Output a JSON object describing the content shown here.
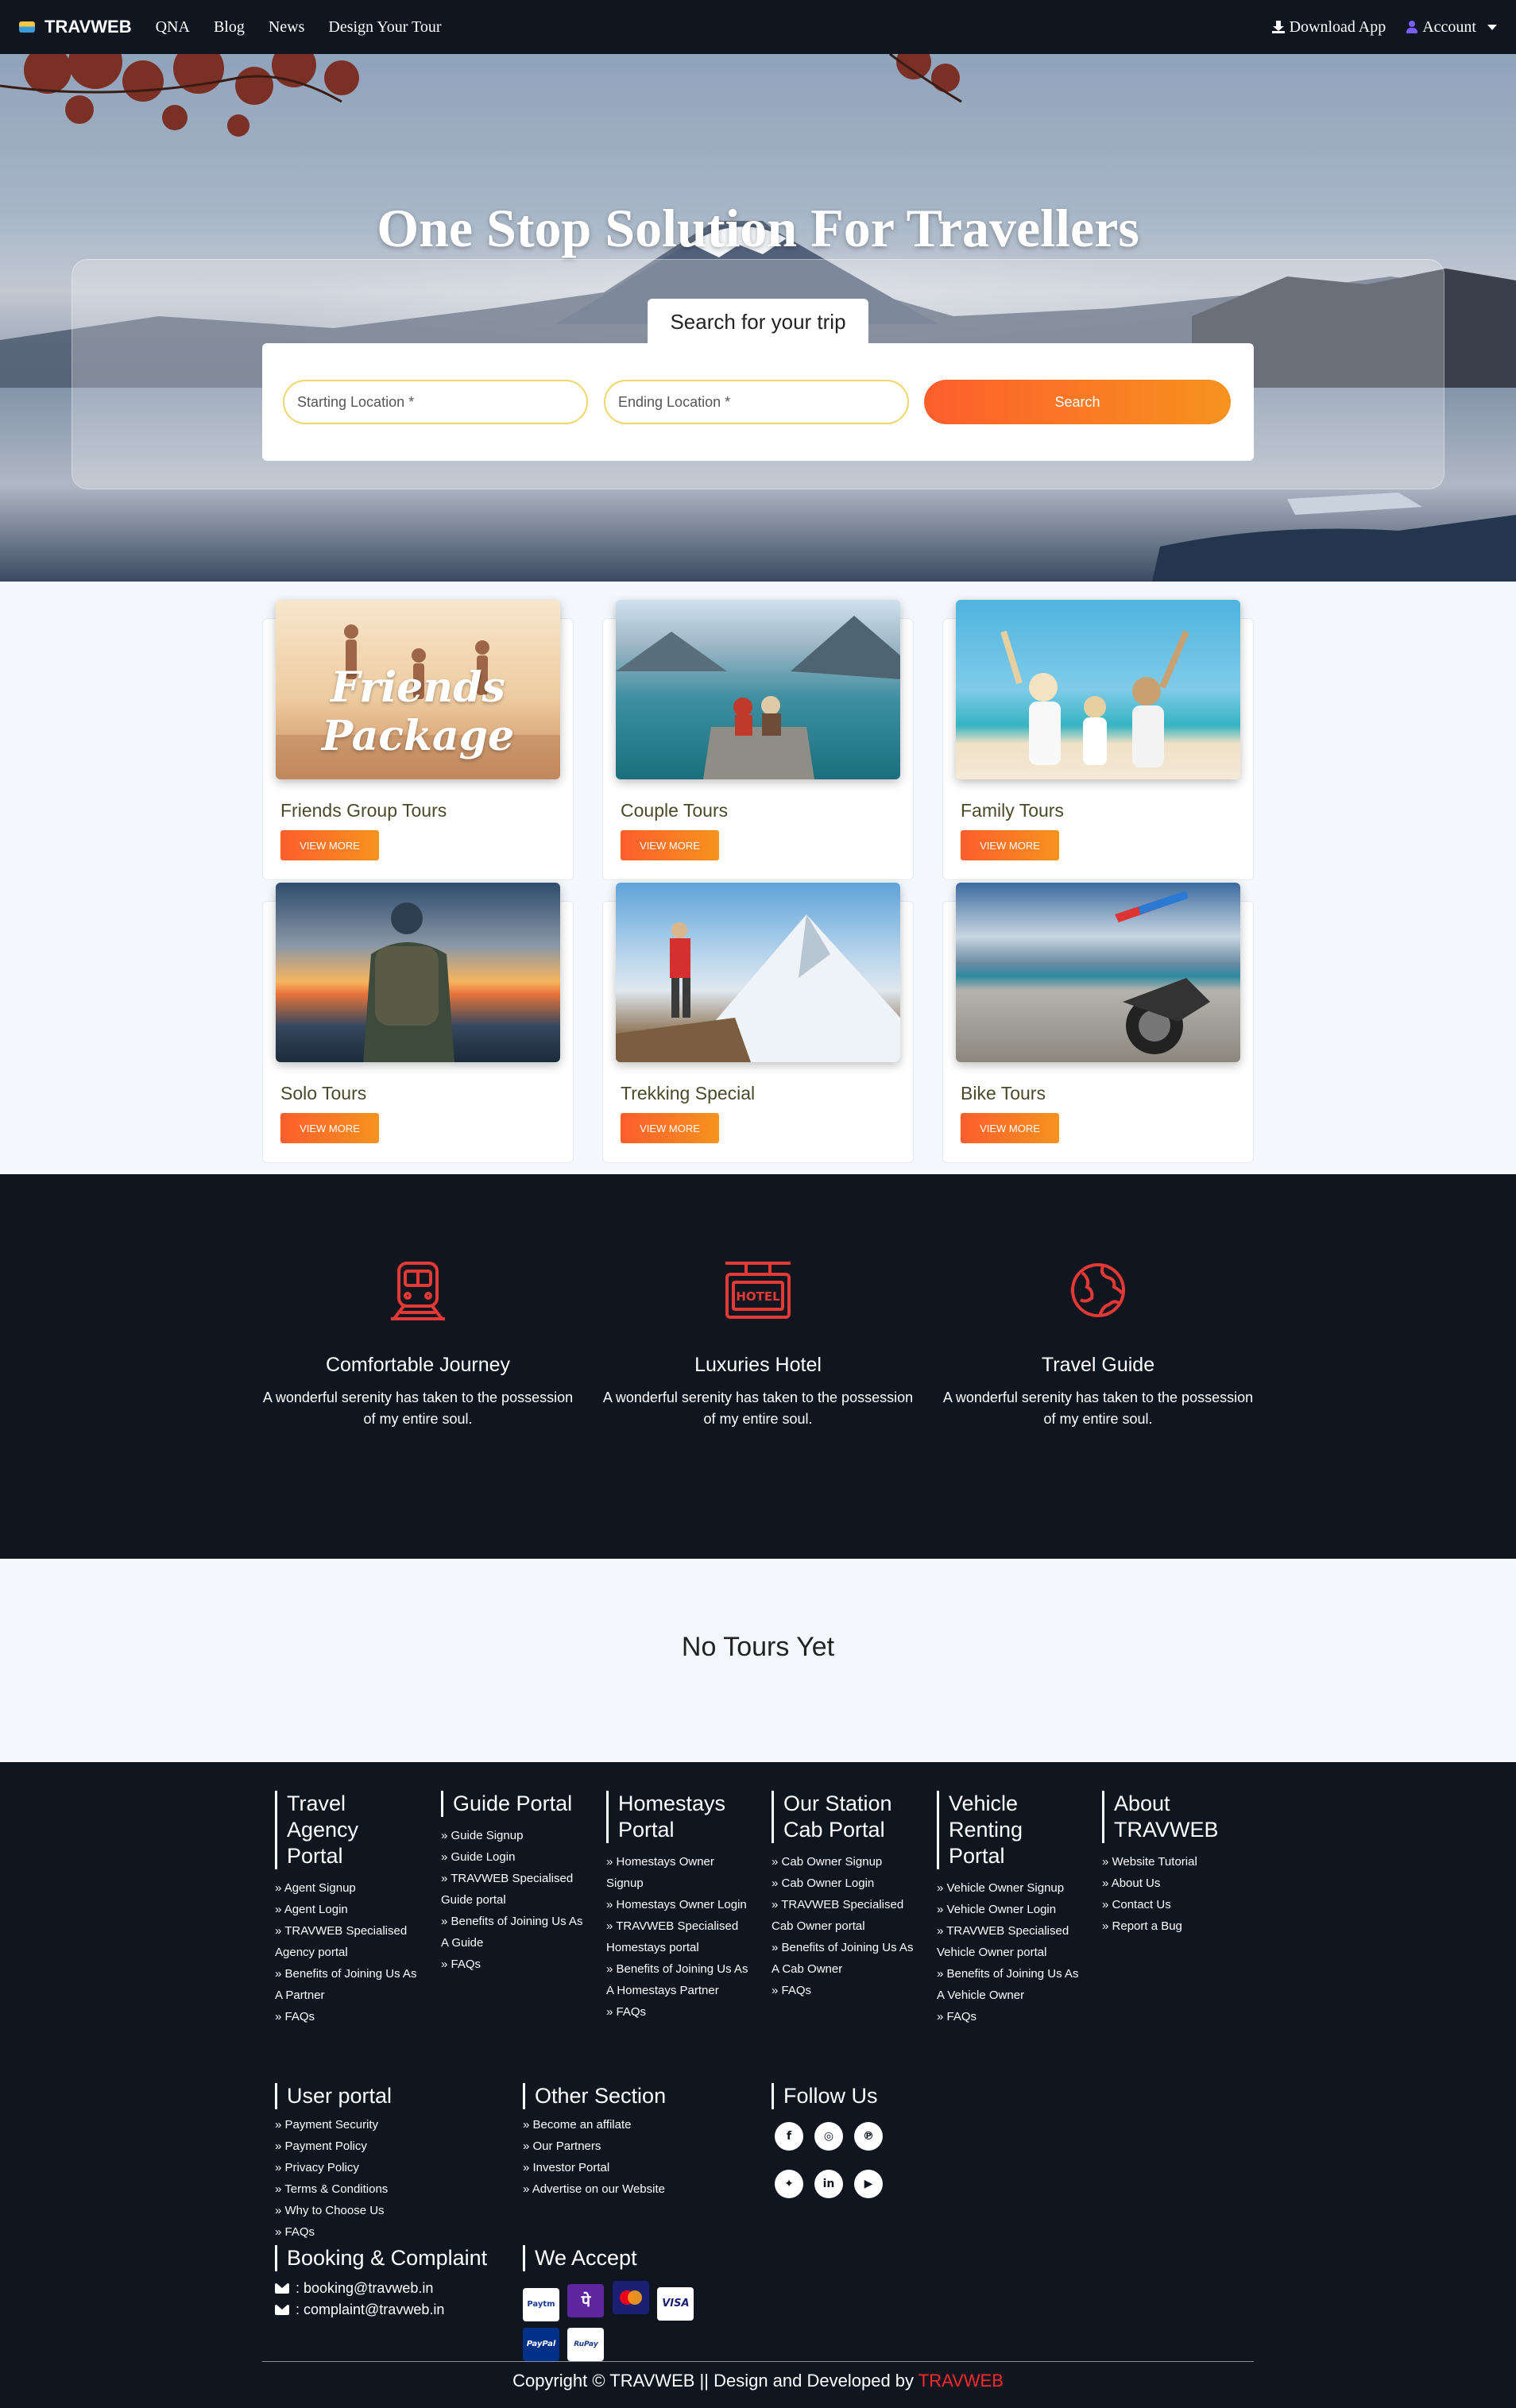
{
  "nav": {
    "brand": "TRAVWEB",
    "links": [
      "QNA",
      "Blog",
      "News",
      "Design Your Tour"
    ],
    "download": "Download App",
    "account": "Account"
  },
  "hero": {
    "title": "One Stop Solution For Travellers",
    "search_tab": "Search for your trip",
    "start_placeholder": "Starting Location *",
    "end_placeholder": "Ending Location *",
    "search_button": "Search"
  },
  "tours": [
    {
      "title": "Friends Group Tours",
      "button": "VIEW MORE",
      "image_text": "Friends Package"
    },
    {
      "title": "Couple Tours",
      "button": "VIEW MORE"
    },
    {
      "title": "Family Tours",
      "button": "VIEW MORE"
    },
    {
      "title": "Solo Tours",
      "button": "VIEW MORE"
    },
    {
      "title": "Trekking Special",
      "button": "VIEW MORE"
    },
    {
      "title": "Bike Tours",
      "button": "VIEW MORE"
    }
  ],
  "features": [
    {
      "title": "Comfortable Journey",
      "desc": "A wonderful serenity has taken to the possession of my entire soul.",
      "icon": "train-icon"
    },
    {
      "title": "Luxuries Hotel",
      "desc": "A wonderful serenity has taken to the possession of my entire soul.",
      "icon": "hotel-icon",
      "icon_text": "HOTEL"
    },
    {
      "title": "Travel Guide",
      "desc": "A wonderful serenity has taken to the possession of my entire soul.",
      "icon": "globe-icon"
    }
  ],
  "no_tours": "No Tours Yet",
  "footer": {
    "travel_agency": {
      "title": "Travel Agency Portal",
      "items": [
        "Agent Signup",
        "Agent Login",
        "TRAVWEB Specialised Agency portal",
        "Benefits of Joining Us As A Partner",
        "FAQs"
      ]
    },
    "guide": {
      "title": "Guide Portal",
      "items": [
        "Guide Signup",
        "Guide Login",
        "TRAVWEB Specialised Guide portal",
        "Benefits of Joining Us As A Guide",
        "FAQs"
      ]
    },
    "homestays": {
      "title": "Homestays Portal",
      "items": [
        "Homestays Owner Signup",
        "Homestays Owner Login",
        "TRAVWEB Specialised Homestays portal",
        "Benefits of Joining Us As A Homestays Partner",
        "FAQs"
      ]
    },
    "cab": {
      "title": "Our Station Cab Portal",
      "items": [
        "Cab Owner Signup",
        "Cab Owner Login",
        "TRAVWEB Specialised Cab Owner portal",
        "Benefits of Joining Us As A Cab Owner",
        "FAQs"
      ]
    },
    "vehicle": {
      "title": "Vehicle Renting Portal",
      "items": [
        "Vehicle Owner Signup",
        "Vehicle Owner Login",
        "TRAVWEB Specialised Vehicle Owner portal",
        "Benefits of Joining Us As A Vehicle Owner",
        "FAQs"
      ]
    },
    "about": {
      "title": "About TRAVWEB",
      "items": [
        "Website Tutorial",
        "About Us",
        "Contact Us",
        "Report a Bug"
      ]
    },
    "user": {
      "title": "User portal",
      "items": [
        "Payment Security",
        "Payment Policy",
        "Privacy Policy",
        "Terms & Conditions",
        "Why to Choose Us",
        "FAQs"
      ]
    },
    "other": {
      "title": "Other Section",
      "items": [
        "Become an affilate",
        "Our Partners",
        "Investor Portal",
        "Advertise on our Website"
      ]
    },
    "follow": {
      "title": "Follow Us",
      "icons": [
        "facebook-icon",
        "instagram-icon",
        "pinterest-icon",
        "twitter-icon",
        "linkedin-icon",
        "youtube-icon"
      ]
    },
    "booking": {
      "title": "Booking & Complaint",
      "booking_email": ": booking@travweb.in",
      "complaint_email": ": complaint@travweb.in"
    },
    "accept": {
      "title": "We Accept",
      "methods": [
        "Paytm",
        "PhonePe",
        "Mastercard",
        "VISA",
        "PayPal",
        "RuPay"
      ]
    },
    "copyright_prefix": "Copyright © TRAVWEB || Design and Developed by ",
    "copyright_brand": "TRAVWEB"
  },
  "colors": {
    "accent_orange": "#fd5e2c",
    "dark_bg": "#0f1620",
    "feature_icon_red": "#e53935"
  }
}
